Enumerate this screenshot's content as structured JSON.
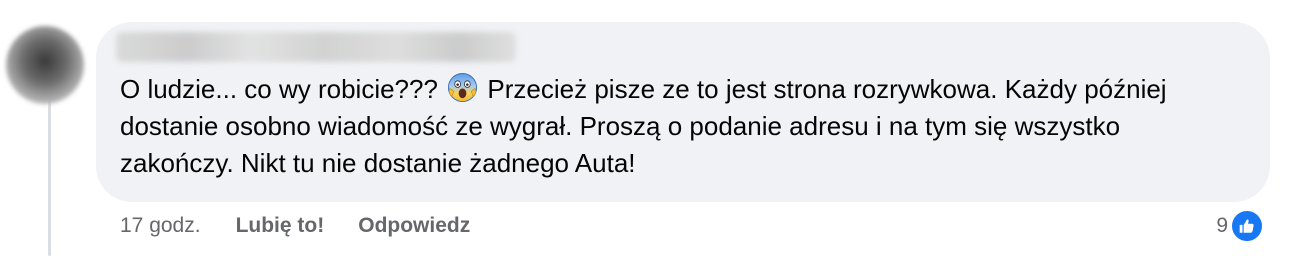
{
  "comment": {
    "text_before_emoji": "O ludzie... co wy robicie???",
    "emoji": "face-screaming-in-fear",
    "text_after_emoji": "Przecież pisze ze to jest strona rozrywkowa. Każdy później dostanie osobno wiadomość ze wygrał. Proszą o podanie adresu i na tym się wszystko zakończy. Nikt tu nie dostanie żadnego Auta!"
  },
  "actions": {
    "timestamp": "17 godz.",
    "like_label": "Lubię to!",
    "reply_label": "Odpowiedz"
  },
  "reactions": {
    "count": "9",
    "type": "like",
    "color": "#1877f2"
  },
  "colors": {
    "bubble": "#f0f2f5",
    "text": "#050505",
    "meta": "#65676b"
  }
}
